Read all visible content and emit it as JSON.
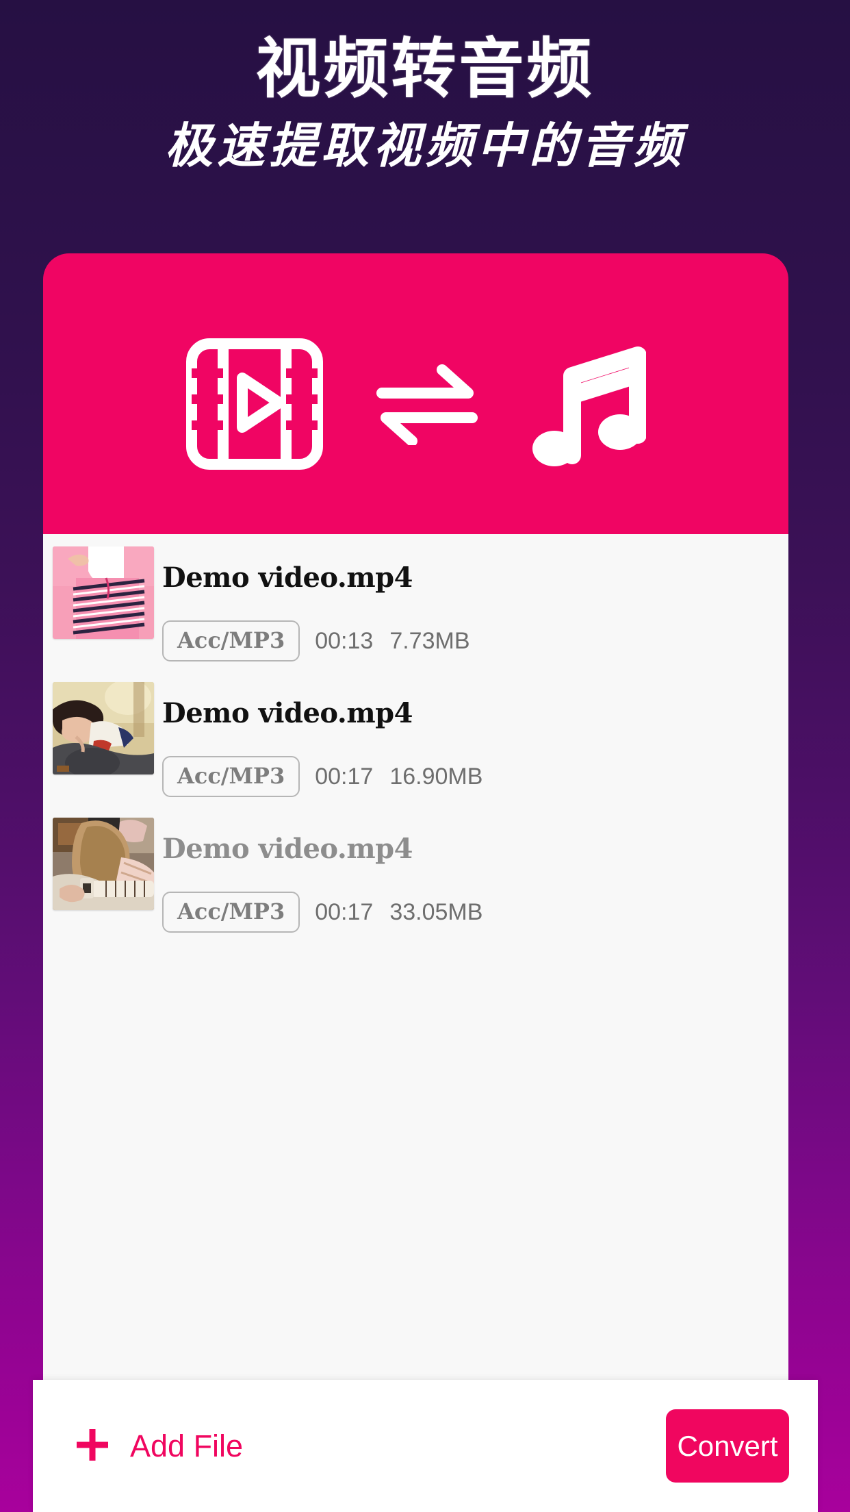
{
  "header": {
    "title": "视频转音频",
    "subtitle": "极速提取视频中的音频"
  },
  "hero": {
    "background_color": "#F00563",
    "video_icon": "film-play-icon",
    "swap_icon": "swap-arrows-icon",
    "audio_icon": "music-note-icon"
  },
  "file_list": [
    {
      "thumbnail": "thumbnail-pink-striped-pants",
      "name": "Demo video.mp4",
      "format": "Acc/MP3",
      "duration": "00:13",
      "size": "7.73MB"
    },
    {
      "thumbnail": "thumbnail-woman-with-guitar",
      "name": "Demo video.mp4",
      "format": "Acc/MP3",
      "duration": "00:17",
      "size": "16.90MB"
    },
    {
      "thumbnail": "thumbnail-guitar-player",
      "name": "Demo video.mp4",
      "format": "Acc/MP3",
      "duration": "00:17",
      "size": "33.05MB"
    }
  ],
  "bottom_bar": {
    "add_file_icon": "plus-icon",
    "add_file_label": "Add File",
    "convert_label": "Convert",
    "accent_color": "#F0065F"
  }
}
